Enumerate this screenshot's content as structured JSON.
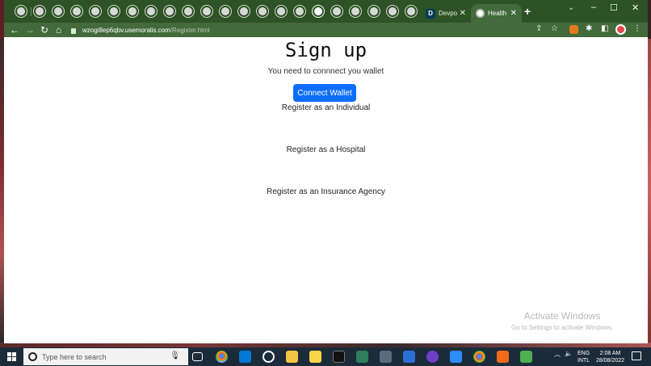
{
  "browser": {
    "tabs": [
      {
        "label": "Devpost",
        "favicon": "D",
        "active": false
      },
      {
        "label": "Health I",
        "active": true
      }
    ],
    "new_tab_label": "+",
    "url_host": "wzogi8ep6qbv.usemoralis.com",
    "url_path": "/Register.html"
  },
  "page": {
    "title": "Sign up",
    "subtitle": "You need to connnect you wallet",
    "connect_button": "Connect Wallet",
    "links": [
      "Register as an Individual",
      "Register as a Hospital",
      "Register as an Insurance Agency"
    ],
    "watermark_title": "Activate Windows",
    "watermark_sub": "Go to Settings to activate Windows."
  },
  "taskbar": {
    "search_placeholder": "Type here to search",
    "lang_line1": "ENG",
    "lang_line2": "INTL",
    "time": "2:08 AM",
    "date": "28/08/2022"
  },
  "colors": {
    "tab_strip": "#2d5225",
    "toolbar": "#426a3b",
    "button_primary": "#0d6efd",
    "taskbar": "#1c2b3a"
  }
}
